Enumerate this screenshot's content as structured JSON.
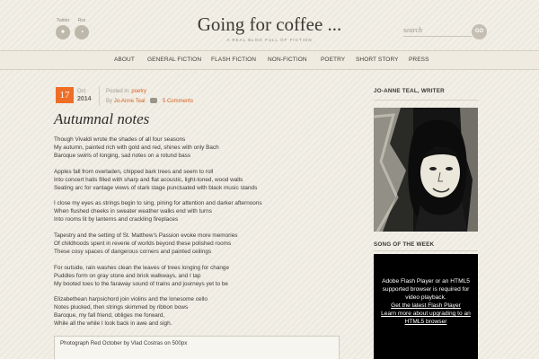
{
  "header": {
    "social": [
      {
        "label": "Twitter",
        "icon": "twitter-bird-icon",
        "glyph": "✦"
      },
      {
        "label": "Rss",
        "icon": "rss-feed-icon",
        "glyph": "◔"
      }
    ],
    "title": "Going for coffee ...",
    "tagline": "A REAL BLOG FULL OF FICTION",
    "search_placeholder": "search",
    "search_button": "GO"
  },
  "nav": [
    "ABOUT",
    "GENERAL FICTION",
    "FLASH FICTION",
    "NON-FICTION",
    "POETRY",
    "SHORT STORY",
    "PRESS"
  ],
  "post": {
    "day": "17",
    "month": "Oct",
    "year": "2014",
    "posted_in_label": "Posted in:",
    "category": "poetry",
    "by_label": "By",
    "author": "Jo-Anne Teal",
    "comments": "5 Comments",
    "title": "Autumnal notes",
    "stanzas": [
      [
        "Though Vivaldi wrote the shades of all four seasons",
        "My autumn, painted rich with gold and red, shines with only Bach",
        "Baroque swirls of longing, sad notes on a rotund bass"
      ],
      [
        "Apples fall from overladen, chipped bark trees and seem to roll",
        "Into concert halls filled with sharp and flat acoustic, light-toned, wood walls",
        "Seating arc for vantage views of stark stage punctuated with black music stands"
      ],
      [
        "I close my eyes as strings begin to sing, pining for attention and darker afternoons",
        "When flushed cheeks in sweater weather walks end with turns",
        "Into rooms lit by lanterns and crackling fireplaces"
      ],
      [
        "Tapestry and the setting of St. Matthew’s Passion evoke more memories",
        "Of childhoods spent in reverie of worlds beyond these polished rooms",
        "These cosy spaces of dangerous corners and painted ceilings"
      ],
      [
        "For outside, rain washes clean the leaves of trees longing for change",
        "Puddles form on gray stone and brick walkways, and I tap",
        "My booted toes to the faraway sound of trains and journeys yet to be"
      ],
      [
        "Elizabethean harpsichord join violins and the lonesome cello",
        "Notes plucked, then strings skimmed by ribbon bows",
        "Baroque, my fall friend, obliges me forward,",
        "While all the while I look back in awe and sigh."
      ]
    ],
    "caption": "Photograph Red October by Vlad Costras on 500px"
  },
  "sidebar": {
    "author_title": "JO-ANNE TEAL, WRITER",
    "song_title": "SONG OF THE WEEK",
    "flash_lines": [
      "Adobe Flash Player or an HTML5",
      "supported browser is required for",
      "video playback."
    ],
    "flash_link1": "Get the latest Flash Player",
    "flash_link2_lines": [
      "Learn more about upgrading to an",
      "HTML5 browser"
    ]
  },
  "colors": {
    "accent": "#ee6e26",
    "link": "#d9621f",
    "background": "#f2efe6"
  }
}
